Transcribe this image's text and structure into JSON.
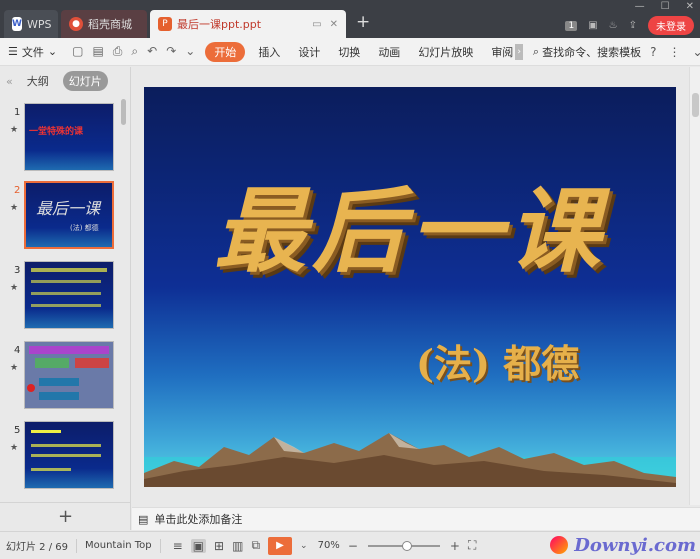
{
  "titlebar": {
    "tabs": [
      {
        "label": "WPS"
      },
      {
        "label": "稻壳商城"
      },
      {
        "label": "最后一课ppt.ppt"
      }
    ],
    "badge": "1",
    "login": "未登录"
  },
  "menubar": {
    "file": "文件",
    "items": [
      "开始",
      "插入",
      "设计",
      "切换",
      "动画",
      "幻灯片放映",
      "审阅"
    ],
    "search": "查找命令、搜索模板",
    "help": "?"
  },
  "leftpanel": {
    "tabs": [
      "大纲",
      "幻灯片"
    ],
    "slides": [
      {
        "num": "1",
        "text": "一堂特殊的课"
      },
      {
        "num": "2",
        "text": "最后一课",
        "sub": "(法) 都德"
      },
      {
        "num": "3",
        "text": ""
      },
      {
        "num": "4",
        "text": ""
      },
      {
        "num": "5",
        "text": ""
      }
    ],
    "add": "+"
  },
  "slide": {
    "title": "最后一课",
    "subtitle": "(法) 都德"
  },
  "notes": {
    "placeholder": "单击此处添加备注"
  },
  "statusbar": {
    "slide_info": "幻灯片 2 / 69",
    "theme": "Mountain Top",
    "zoom": "70%"
  },
  "watermark": {
    "text": "Downyi.com"
  },
  "colors": {
    "accent": "#ec6d3a",
    "title_gold": "#e8b450",
    "slide_bg": "#0e2f95"
  }
}
